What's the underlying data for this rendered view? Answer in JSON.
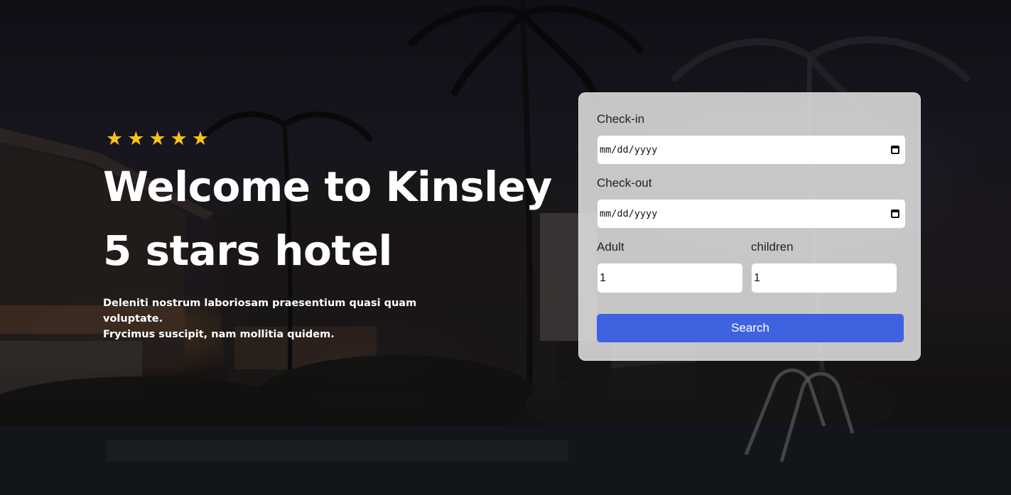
{
  "hero": {
    "rating_stars": 5,
    "star_icon": "star-icon",
    "star_color": "#f5c518",
    "title_line1": "Welcome to Kinsley",
    "title_line2": "5 stars hotel",
    "subtitle_line1": "Deleniti nostrum laboriosam praesentium quasi quam voluptate.",
    "subtitle_line2": "Frycimus suscipit, nam mollitia quidem."
  },
  "booking": {
    "checkin_label": "Check-in",
    "checkin_value": "mm/dd/yyyy",
    "checkout_label": "Check-out",
    "checkout_value": "mm/dd/yyyy",
    "adult_label": "Adult",
    "adult_value": "1",
    "children_label": "children",
    "children_value": "1",
    "search_label": "Search",
    "calendar_icon": "calendar-icon",
    "button_color": "#3f63e0"
  }
}
